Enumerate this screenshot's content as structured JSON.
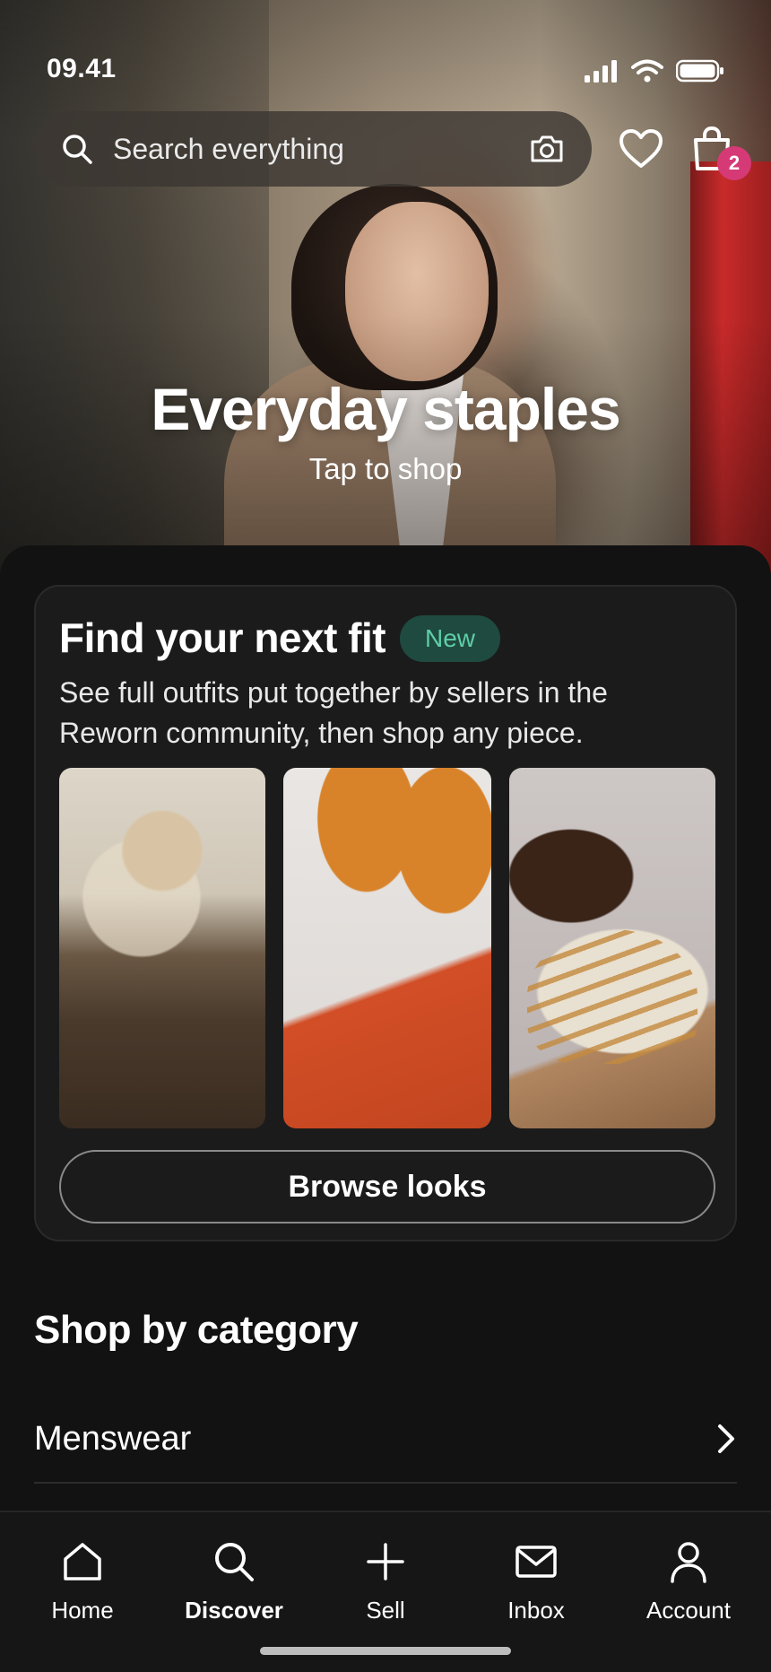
{
  "status_bar": {
    "time": "09.41"
  },
  "search": {
    "placeholder": "Search everything",
    "cart_count": "2"
  },
  "hero": {
    "title": "Everyday staples",
    "subtitle": "Tap to shop"
  },
  "fit_card": {
    "title": "Find your next fit",
    "badge": "New",
    "description": "See full outfits put together by sellers in the Reworn community, then shop any piece.",
    "button": "Browse looks"
  },
  "categories": {
    "title": "Shop by category",
    "items": [
      {
        "label": "Menswear"
      }
    ]
  },
  "tabbar": {
    "items": [
      {
        "label": "Home",
        "icon": "home-icon"
      },
      {
        "label": "Discover",
        "icon": "search-icon",
        "active": true
      },
      {
        "label": "Sell",
        "icon": "plus-icon"
      },
      {
        "label": "Inbox",
        "icon": "mail-icon"
      },
      {
        "label": "Account",
        "icon": "person-icon"
      }
    ]
  },
  "colors": {
    "accent_badge": "#d63a76",
    "new_badge_bg": "#1f4a3f",
    "new_badge_text": "#5fcda8",
    "background": "#121212"
  }
}
